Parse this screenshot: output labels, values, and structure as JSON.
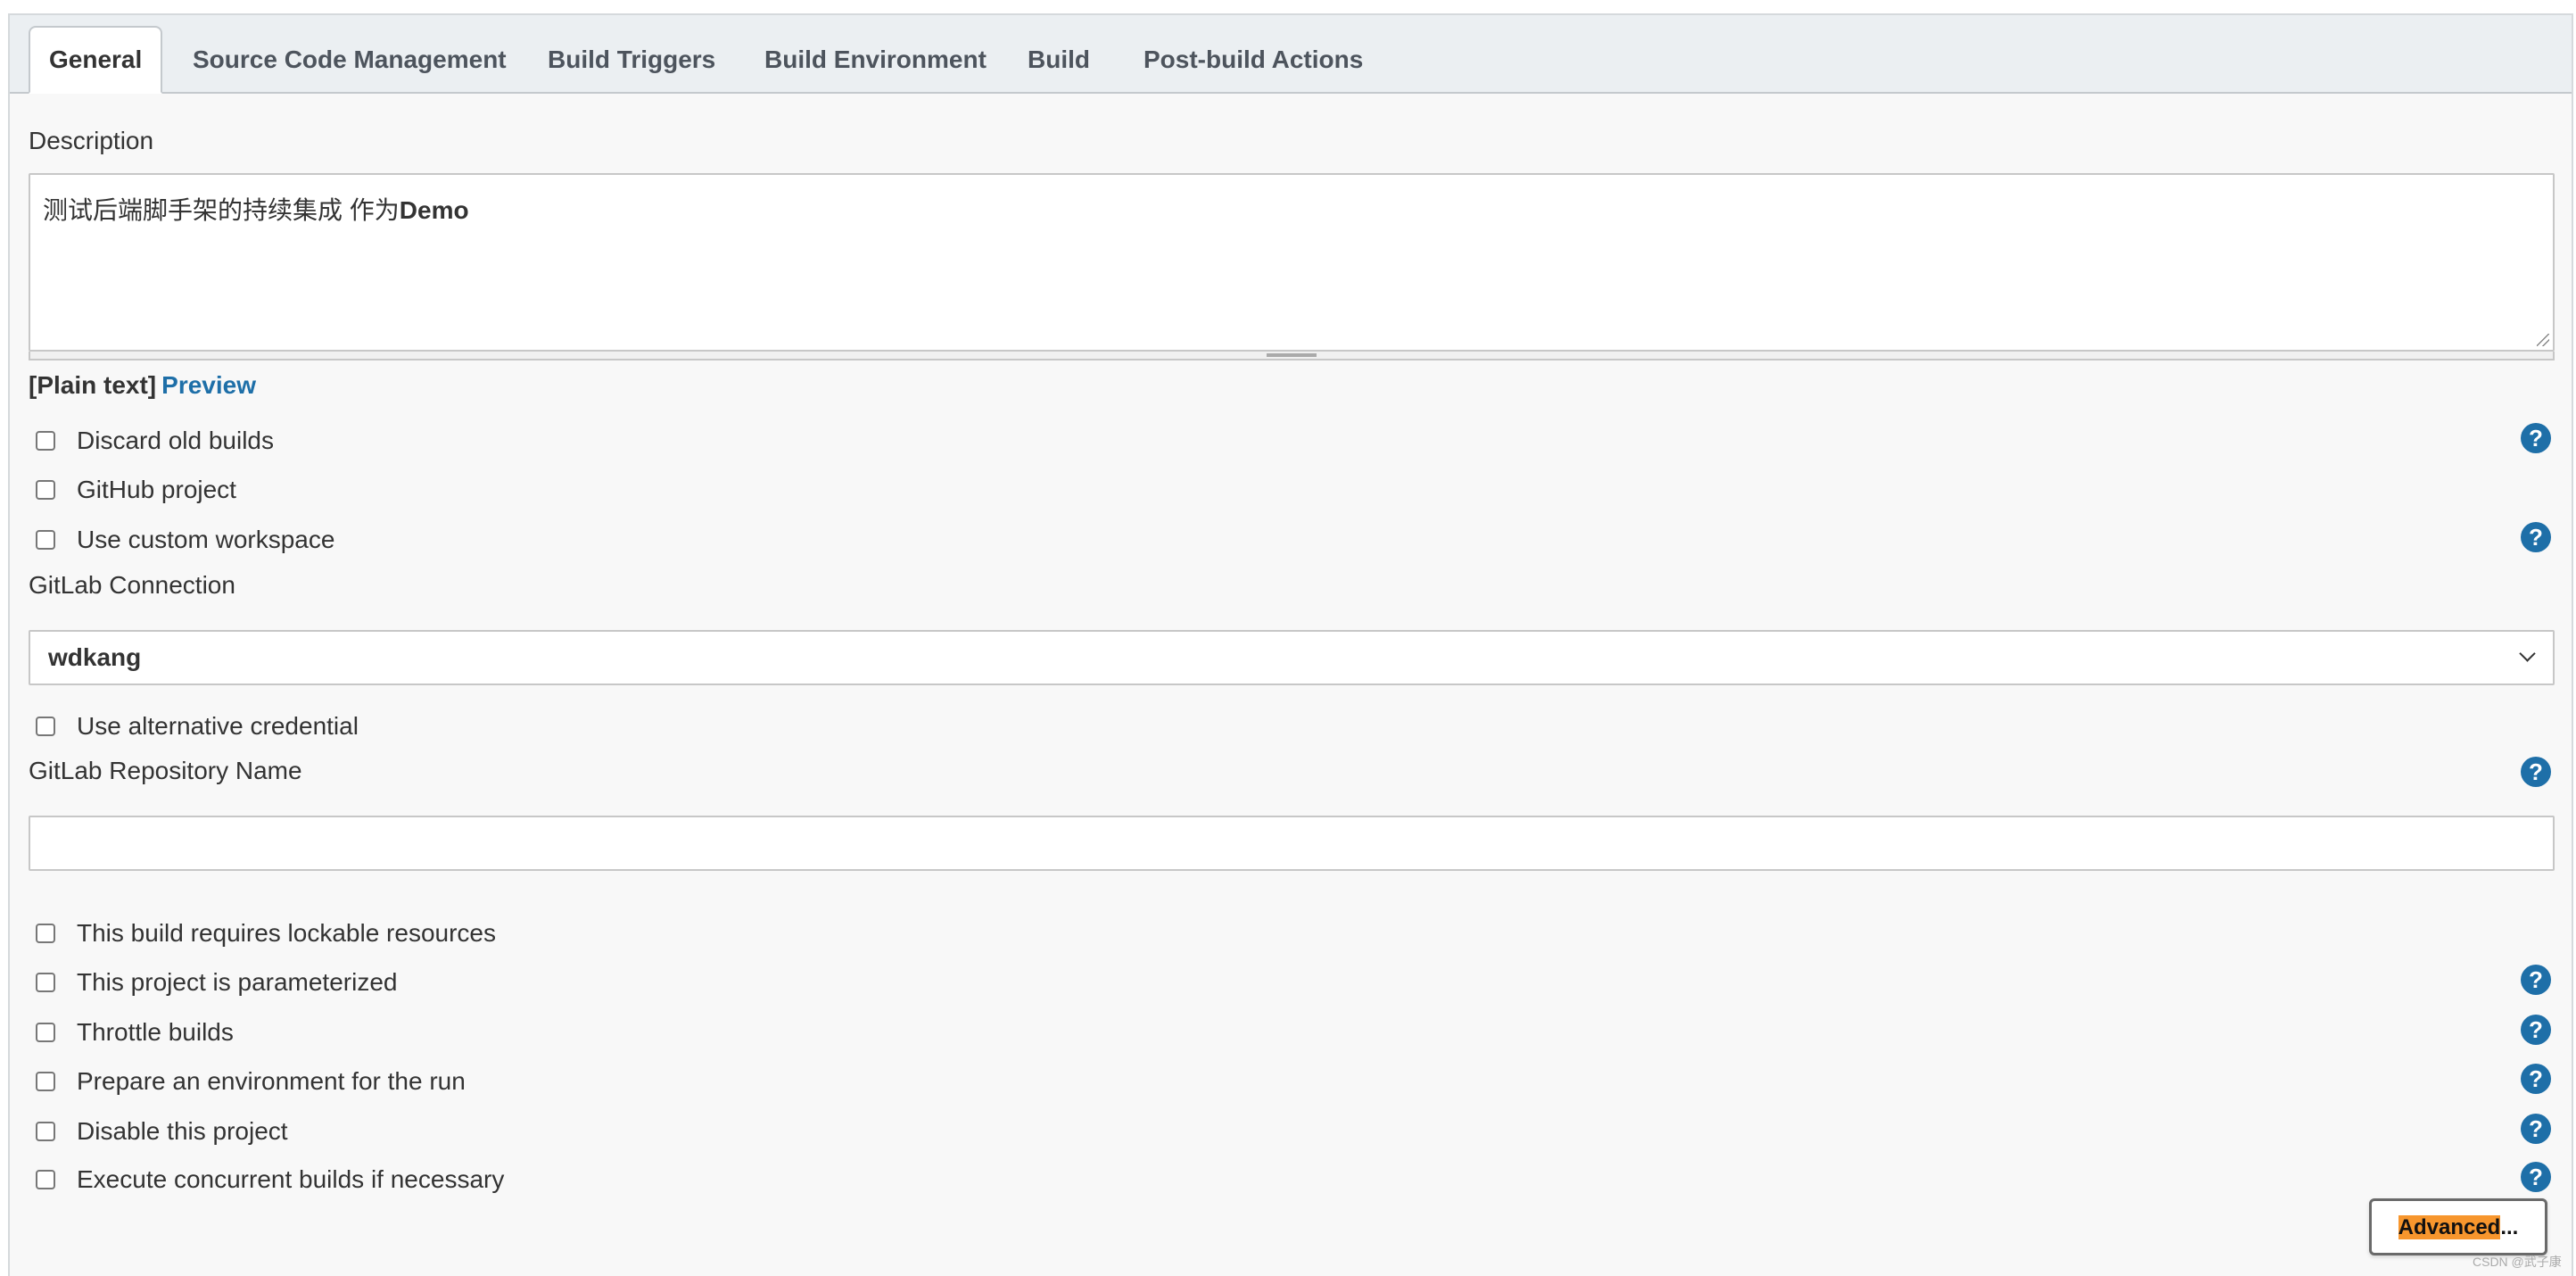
{
  "tabs": [
    {
      "label": "General",
      "active": true
    },
    {
      "label": "Source Code Management",
      "active": false
    },
    {
      "label": "Build Triggers",
      "active": false
    },
    {
      "label": "Build Environment",
      "active": false
    },
    {
      "label": "Build",
      "active": false
    },
    {
      "label": "Post-build Actions",
      "active": false
    }
  ],
  "description": {
    "label": "Description",
    "text_plain": "测试后端脚手架的持续集成 作为",
    "text_bold": "Demo",
    "format_current": "[Plain text]",
    "format_preview": "Preview"
  },
  "checkboxes_top": [
    {
      "label": "Discard old builds",
      "checked": false,
      "help": true
    },
    {
      "label": "GitHub project",
      "checked": false,
      "help": false
    },
    {
      "label": "Use custom workspace",
      "checked": false,
      "help": true
    }
  ],
  "gitlab_connection": {
    "label": "GitLab Connection",
    "selected": "wdkang"
  },
  "alt_credential": {
    "label": "Use alternative credential",
    "checked": false
  },
  "gitlab_repo": {
    "label": "GitLab Repository Name",
    "value": ""
  },
  "checkboxes_bottom": [
    {
      "label": "This build requires lockable resources",
      "checked": false,
      "help": false
    },
    {
      "label": "This project is parameterized",
      "checked": false,
      "help": true
    },
    {
      "label": "Throttle builds",
      "checked": false,
      "help": true
    },
    {
      "label": "Prepare an environment for the run",
      "checked": false,
      "help": true
    },
    {
      "label": "Disable this project",
      "checked": false,
      "help": true
    },
    {
      "label": "Execute concurrent builds if necessary",
      "checked": false,
      "help": true
    }
  ],
  "advanced_button": {
    "label_highlight": "Advanced",
    "label_rest": "..."
  },
  "help_glyph": "?",
  "watermark": "CSDN @武子康",
  "colors": {
    "link_blue": "#1e6fa8",
    "highlight_orange": "#f7962d",
    "tabbar_bg": "#ebeff2"
  }
}
